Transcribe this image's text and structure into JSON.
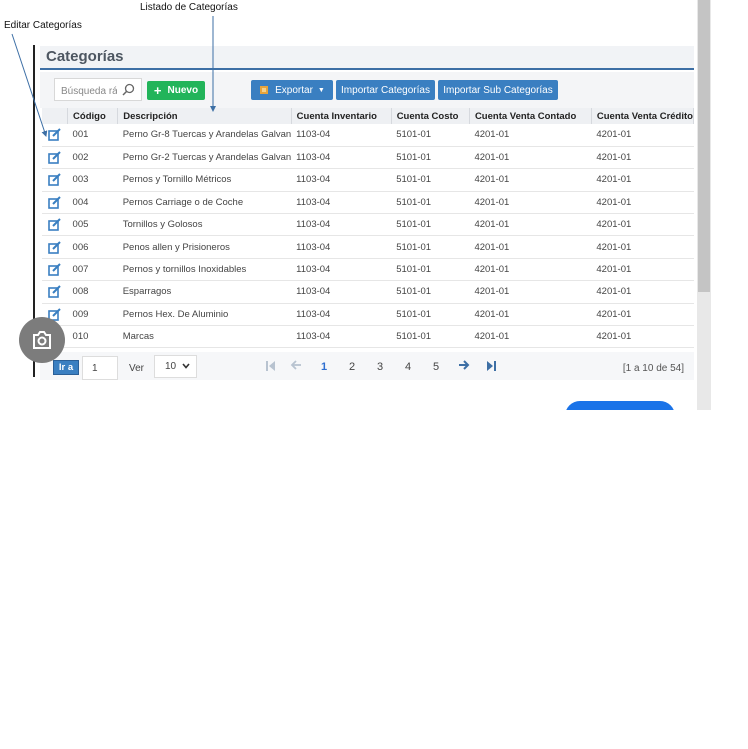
{
  "annotations": {
    "list_label": "Listado de Categorías",
    "edit_label": "Editar Categorías"
  },
  "panel": {
    "title": "Categorías"
  },
  "toolbar": {
    "search_placeholder": "Búsqueda ráp",
    "new_label": "Nuevo",
    "export_label": "Exportar",
    "import_categories_label": "Importar Categorías",
    "import_subcategories_label": "Importar Sub Categorías"
  },
  "table": {
    "headers": [
      "Código",
      "Descripción",
      "Cuenta Inventario",
      "Cuenta Costo",
      "Cuenta Venta Contado",
      "Cuenta Venta Crédito"
    ],
    "rows": [
      [
        "001",
        "Perno Gr-8 Tuercas y Arandelas Galvan",
        "1103-04",
        "5101-01",
        "4201-01",
        "4201-01"
      ],
      [
        "002",
        "Perno Gr-2 Tuercas y Arandelas Galvan",
        "1103-04",
        "5101-01",
        "4201-01",
        "4201-01"
      ],
      [
        "003",
        "Pernos y Tornillo Métricos",
        "1103-04",
        "5101-01",
        "4201-01",
        "4201-01"
      ],
      [
        "004",
        "Pernos Carriage o de Coche",
        "1103-04",
        "5101-01",
        "4201-01",
        "4201-01"
      ],
      [
        "005",
        "Tornillos y Golosos",
        "1103-04",
        "5101-01",
        "4201-01",
        "4201-01"
      ],
      [
        "006",
        "Penos allen y Prisioneros",
        "1103-04",
        "5101-01",
        "4201-01",
        "4201-01"
      ],
      [
        "007",
        "Pernos y tornillos Inoxidables",
        "1103-04",
        "5101-01",
        "4201-01",
        "4201-01"
      ],
      [
        "008",
        "Esparragos",
        "1103-04",
        "5101-01",
        "4201-01",
        "4201-01"
      ],
      [
        "009",
        "Pernos Hex. De Aluminio",
        "1103-04",
        "5101-01",
        "4201-01",
        "4201-01"
      ],
      [
        "010",
        "Marcas",
        "1103-04",
        "5101-01",
        "4201-01",
        "4201-01"
      ]
    ]
  },
  "pager": {
    "goto_label": "Ir a",
    "page_value": "1",
    "ver_label": "Ver",
    "per_page": "10",
    "pages": [
      "1",
      "2",
      "3",
      "4",
      "5"
    ],
    "current_page": "1",
    "range_text": "[1 a 10 de 54]"
  },
  "colors": {
    "accent_blue": "#3a7fc1",
    "new_green": "#22b45a",
    "header_rule": "#3d6fa5"
  },
  "icons": [
    "search-icon",
    "plus-icon",
    "export-icon",
    "caret-down-icon",
    "edit-icon",
    "first-page-icon",
    "prev-page-icon",
    "next-page-icon",
    "last-page-icon",
    "chevron-down-icon",
    "camera-search-icon"
  ]
}
